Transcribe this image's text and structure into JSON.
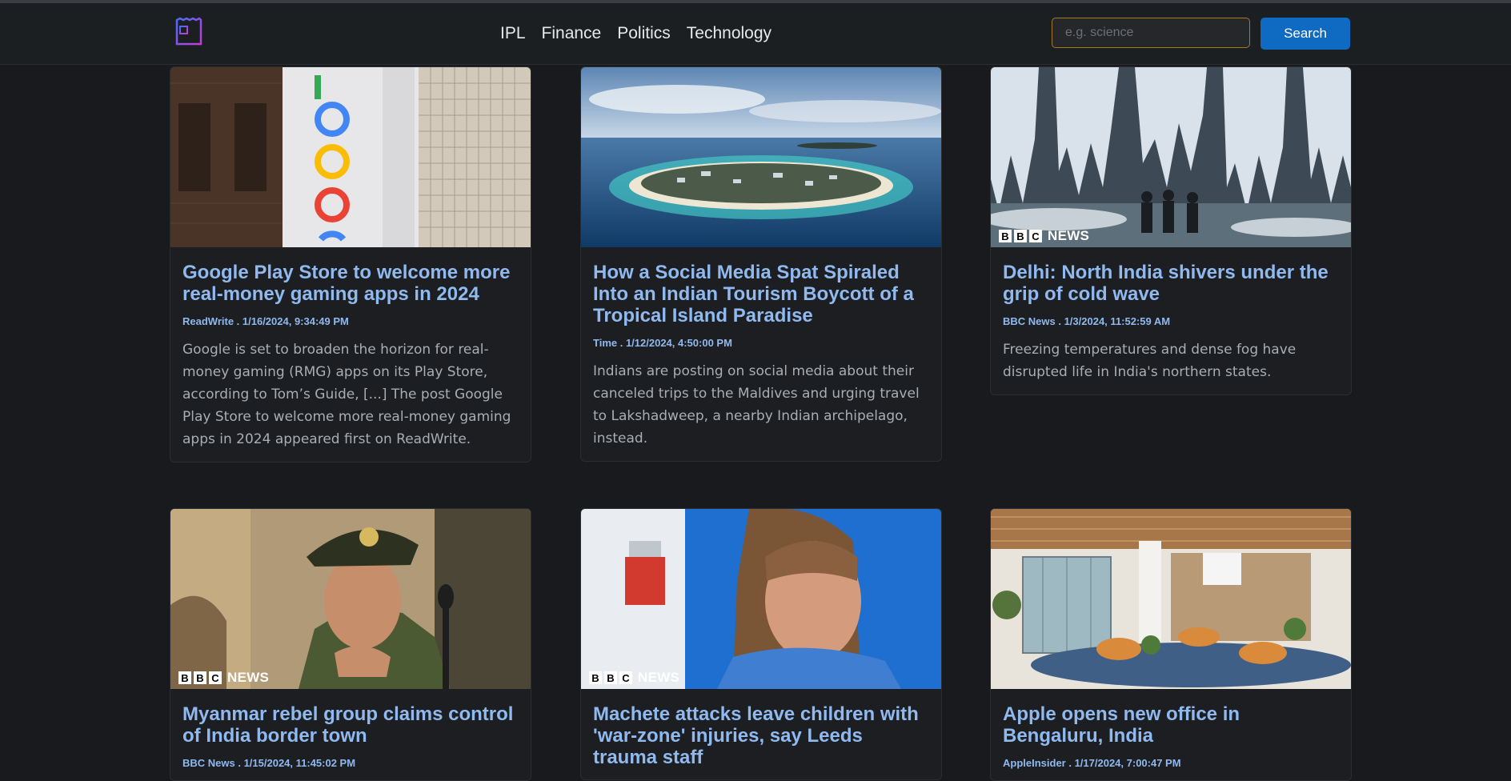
{
  "navbar": {
    "logo_icon": "newspaper-icon",
    "links": [
      "IPL",
      "Finance",
      "Politics",
      "Technology"
    ],
    "search_placeholder": "e.g. science",
    "search_button": "Search"
  },
  "colors": {
    "background": "#181a1d",
    "card_title": "#8fb9ef",
    "search_button": "#0f6ac2",
    "search_border": "#a37a1d"
  },
  "badge": {
    "bbc": [
      "B",
      "B",
      "C"
    ],
    "news": "NEWS"
  },
  "articles": [
    {
      "image": "google-sign-photo",
      "title": "Google Play Store to welcome more real-money gaming apps in 2024",
      "meta": "ReadWrite . 1/16/2024, 9:34:49 PM",
      "description": "Google is set to broaden the horizon for real-money gaming (RMG) apps on its Play Store, according to Tom’s Guide, [...] The post Google Play Store to welcome more real-money gaming apps in 2024 appeared first on ReadWrite."
    },
    {
      "image": "island-aerial-photo",
      "title": "How a Social Media Spat Spiraled Into an Indian Tourism Boycott of a Tropical Island Paradise",
      "meta": "Time . 1/12/2024, 4:50:00 PM",
      "description": "Indians are posting on social media about their canceled trips to the Maldives and urging travel to Lakshadweep, a nearby Indian archipelago, instead."
    },
    {
      "image": "frozen-waterfall-photo",
      "title": "Delhi: North India shivers under the grip of cold wave",
      "meta": "BBC News . 1/3/2024, 11:52:59 AM",
      "description": "Freezing temperatures and dense fog have disrupted life in India's northern states."
    },
    {
      "image": "military-officer-photo",
      "title": "Myanmar rebel group claims control of India border town",
      "meta": "BBC News . 1/15/2024, 11:45:02 PM",
      "description": ""
    },
    {
      "image": "young-woman-photo",
      "title": "Machete attacks leave children with 'war-zone' injuries, say Leeds trauma staff",
      "meta": "",
      "description": ""
    },
    {
      "image": "office-interior-photo",
      "title": "Apple opens new office in Bengaluru, India",
      "meta": "AppleInsider . 1/17/2024, 7:00:47 PM",
      "description": ""
    }
  ]
}
